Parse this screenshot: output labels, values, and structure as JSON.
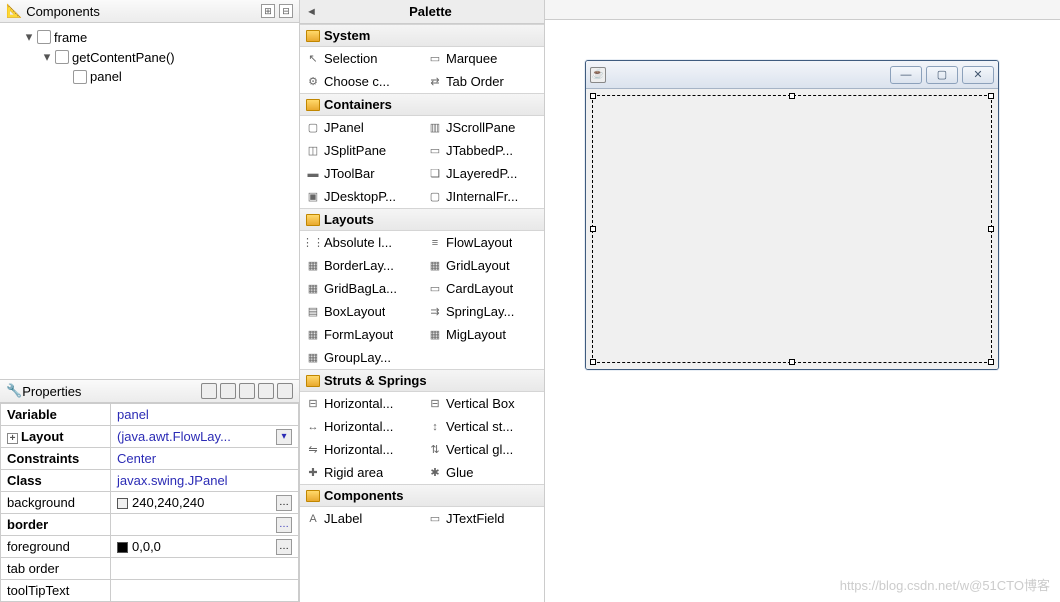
{
  "components_panel": {
    "title": "Components",
    "tree": {
      "frame": "frame",
      "contentpane": "getContentPane()",
      "panel": "panel"
    }
  },
  "properties_panel": {
    "title": "Properties",
    "rows": {
      "variable": "Variable",
      "variable_val": "panel",
      "layout": "Layout",
      "layout_val": "(java.awt.FlowLay...",
      "constraints": "Constraints",
      "constraints_val": "Center",
      "class": "Class",
      "class_val": "javax.swing.JPanel",
      "background": "background",
      "background_val": "240,240,240",
      "border": "border",
      "border_val": "",
      "foreground": "foreground",
      "foreground_val": "0,0,0",
      "taborder": "tab order",
      "taborder_val": "",
      "tooltip": "toolTipText",
      "tooltip_val": ""
    }
  },
  "palette": {
    "title": "Palette",
    "cats": {
      "system": "System",
      "containers": "Containers",
      "layouts": "Layouts",
      "struts": "Struts & Springs",
      "components": "Components"
    },
    "system": {
      "selection": "Selection",
      "marquee": "Marquee",
      "choose": "Choose c...",
      "taborder": "Tab Order"
    },
    "containers": {
      "jpanel": "JPanel",
      "jscrollpane": "JScrollPane",
      "jsplitpane": "JSplitPane",
      "jtabbed": "JTabbedP...",
      "jtoolbar": "JToolBar",
      "jlayered": "JLayeredP...",
      "jdesktop": "JDesktopP...",
      "jinternal": "JInternalFr..."
    },
    "layouts": {
      "absolute": "Absolute l...",
      "flow": "FlowLayout",
      "border": "BorderLay...",
      "grid": "GridLayout",
      "gridbag": "GridBagLa...",
      "card": "CardLayout",
      "box": "BoxLayout",
      "spring": "SpringLay...",
      "form": "FormLayout",
      "mig": "MigLayout",
      "group": "GroupLay..."
    },
    "struts": {
      "hbox": "Horizontal...",
      "vbox": "Vertical Box",
      "hstrut": "Horizontal...",
      "vstrut": "Vertical st...",
      "hglue": "Horizontal...",
      "vglue": "Vertical gl...",
      "rigid": "Rigid area",
      "glue": "Glue"
    },
    "components": {
      "jlabel": "JLabel",
      "jtextfield": "JTextField"
    }
  },
  "watermark": "https://blog.csdn.net/w@51CTO博客"
}
